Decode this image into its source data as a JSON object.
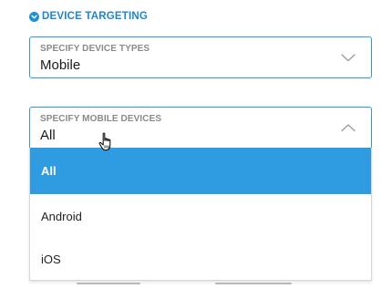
{
  "section": {
    "title": "DEVICE TARGETING",
    "icon": "chevron-down-circle-icon",
    "accent_color": "#1f86c9"
  },
  "device_types": {
    "label": "SPECIFY DEVICE TYPES",
    "value": "Mobile",
    "icon": "chevron-down-icon"
  },
  "mobile_devices": {
    "label": "SPECIFY MOBILE DEVICES",
    "value": "All",
    "icon": "chevron-up-icon",
    "options": [
      {
        "label": "All",
        "selected": true
      },
      {
        "label": "Android",
        "selected": false
      },
      {
        "label": "iOS",
        "selected": false
      }
    ],
    "highlight_color": "#2f9be0"
  },
  "cursor": {
    "icon": "hand-pointer-icon"
  }
}
